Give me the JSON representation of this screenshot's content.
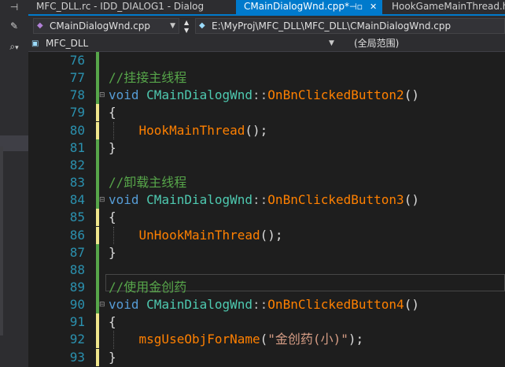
{
  "left_panel": {
    "pin_icon": "pin-icon",
    "wrench_icon": "wrench-icon",
    "search_icon": "search-icon",
    "dropdown": "▾"
  },
  "tabs": [
    {
      "label": "MFC_DLL.rc - IDD_DIALOG1 - Dialog",
      "active": false
    },
    {
      "label": "CMainDialogWnd.cpp*",
      "active": true,
      "pin": "⊣▫",
      "close": "✕"
    },
    {
      "label": "HookGameMainThread.h",
      "active": false
    }
  ],
  "nav": {
    "file_combo": "CMainDialogWnd.cpp",
    "path_combo": "E:\\MyProj\\MFC_DLL\\MFC_DLL\\CMainDialogWnd.cpp"
  },
  "scope": {
    "project": "MFC_DLL",
    "scope": "(全局范围)"
  },
  "code_lines": [
    {
      "n": "76",
      "t": ""
    },
    {
      "n": "77",
      "t": "//挂接主线程"
    },
    {
      "n": "78",
      "t": "void CMainDialogWnd::OnBnClickedButton2()"
    },
    {
      "n": "79",
      "t": "{"
    },
    {
      "n": "80",
      "t": "    HookMainThread();"
    },
    {
      "n": "81",
      "t": "}"
    },
    {
      "n": "82",
      "t": ""
    },
    {
      "n": "83",
      "t": "//卸载主线程"
    },
    {
      "n": "84",
      "t": "void CMainDialogWnd::OnBnClickedButton3()"
    },
    {
      "n": "85",
      "t": "{"
    },
    {
      "n": "86",
      "t": "    UnHookMainThread();"
    },
    {
      "n": "87",
      "t": "}"
    },
    {
      "n": "88",
      "t": ""
    },
    {
      "n": "89",
      "t": "//使用金创药"
    },
    {
      "n": "90",
      "t": "void CMainDialogWnd::OnBnClickedButton4()"
    },
    {
      "n": "91",
      "t": "{"
    },
    {
      "n": "92",
      "t": "    msgUseObjForName(\"金创药(小)\");"
    },
    {
      "n": "93",
      "t": "}"
    }
  ],
  "colors": {
    "accent": "#007acc",
    "keyword": "#569cd6",
    "class": "#4ec9b0",
    "function": "#ff8000",
    "string": "#d69d85",
    "comment": "#57a64a",
    "line_number": "#2b91af",
    "change_saved": "#57a64a",
    "change_unsaved": "#f0e68c"
  }
}
